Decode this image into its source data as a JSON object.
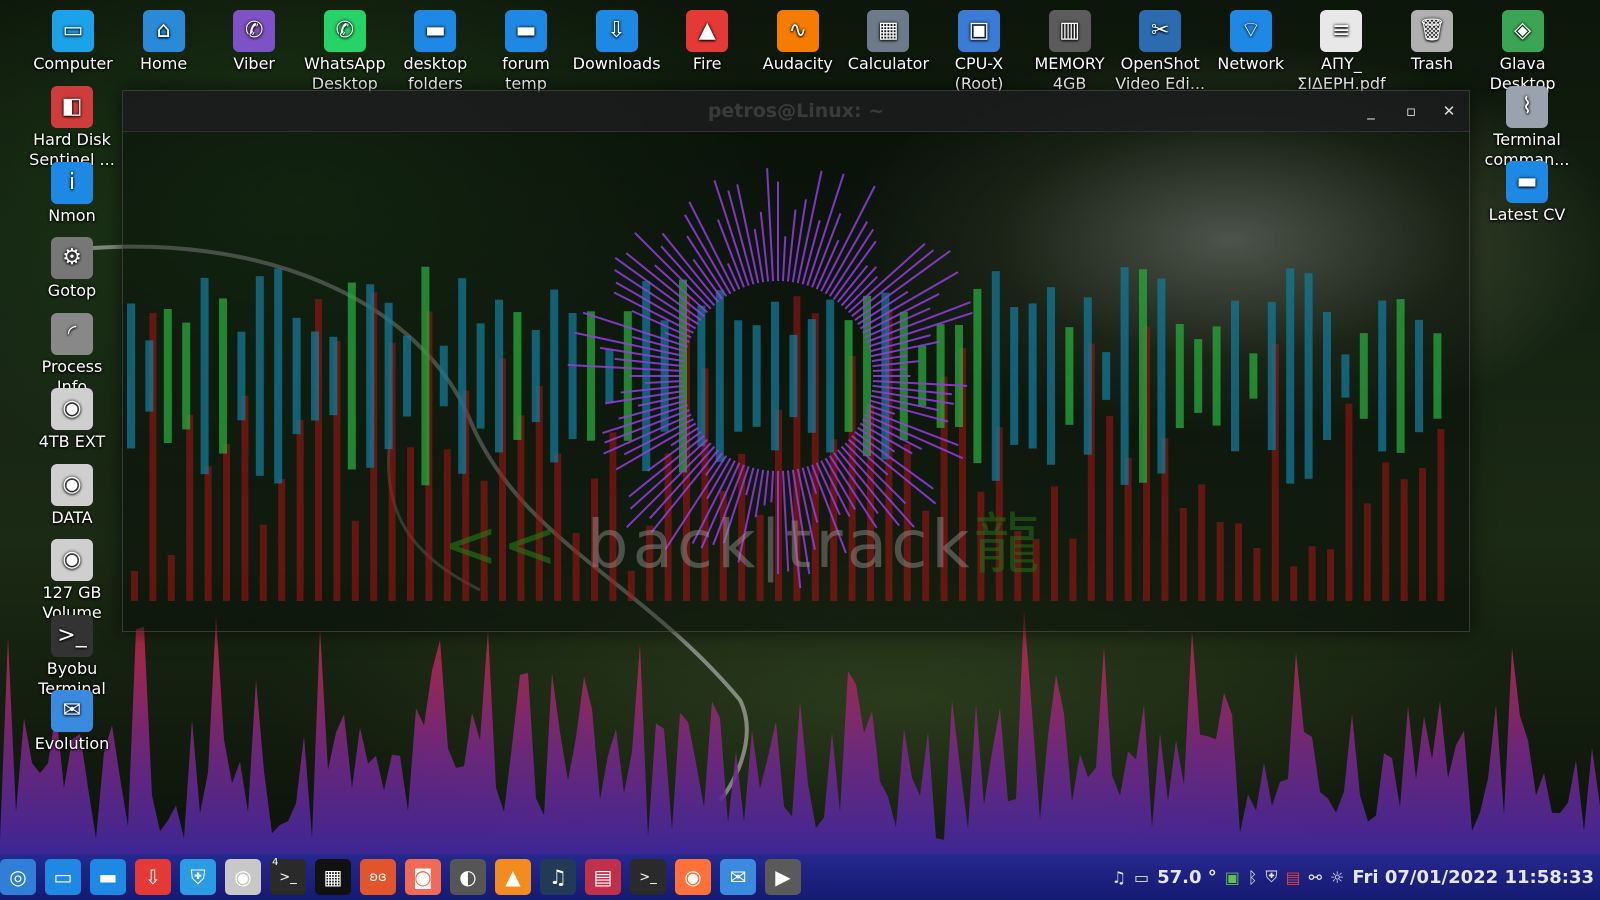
{
  "desktop": {
    "top_icons": [
      {
        "label": "Computer",
        "icon": "monitor-icon",
        "color": "#1aa3e8"
      },
      {
        "label": "Home",
        "icon": "home-folder-icon",
        "color": "#2a8ad8"
      },
      {
        "label": "Viber",
        "icon": "viber-icon",
        "color": "#7d52c7"
      },
      {
        "label": "WhatsApp Desktop",
        "icon": "whatsapp-icon",
        "color": "#25d366"
      },
      {
        "label": "desktop folders",
        "icon": "folder-icon",
        "color": "#1e88e5"
      },
      {
        "label": "forum temp",
        "icon": "folder-icon",
        "color": "#1e88e5"
      },
      {
        "label": "Downloads",
        "icon": "downloads-folder-icon",
        "color": "#1e88e5"
      },
      {
        "label": "Fire",
        "icon": "fire-app-icon",
        "color": "#e53935"
      },
      {
        "label": "Audacity",
        "icon": "audacity-icon",
        "color": "#f57c00"
      },
      {
        "label": "Calculator",
        "icon": "calculator-icon",
        "color": "#6d7a8a"
      },
      {
        "label": "CPU-X (Root)",
        "icon": "cpu-icon",
        "color": "#3a7bd5"
      },
      {
        "label": "MEMORY 4GB",
        "icon": "memory-card-icon",
        "color": "#5c5c5c"
      },
      {
        "label": "OpenShot Video Edi...",
        "icon": "openshot-icon",
        "color": "#2b6cb0"
      },
      {
        "label": "Network",
        "icon": "network-folder-icon",
        "color": "#1e88e5"
      },
      {
        "label": "ΑΠΥ_ ΣΙΔΕΡΗ.pdf",
        "icon": "document-icon",
        "color": "#e8e8e8"
      },
      {
        "label": "Trash",
        "icon": "trash-icon",
        "color": "#b0b0b0"
      },
      {
        "label": "Glava Desktop",
        "icon": "glava-icon",
        "color": "#3aa655"
      }
    ],
    "left_icons": [
      {
        "label": "Hard Disk Sentinel ...",
        "icon": "hard-disk-sentinel-icon",
        "color": "#d03c3c"
      },
      {
        "label": "Nmon",
        "icon": "info-icon",
        "color": "#1e88e5"
      },
      {
        "label": "Gotop",
        "icon": "gear-icon",
        "color": "#777777"
      },
      {
        "label": "Process Info",
        "icon": "process-spinner-icon",
        "color": "#888888"
      },
      {
        "label": "4TB EXT",
        "icon": "drive-icon",
        "color": "#cfcfcf"
      },
      {
        "label": "DATA",
        "icon": "drive-icon",
        "color": "#cfcfcf"
      },
      {
        "label": "127 GB Volume",
        "icon": "drive-icon",
        "color": "#cfcfcf"
      },
      {
        "label": "Byobu Terminal",
        "icon": "terminal-icon",
        "color": "#333333"
      },
      {
        "label": "Evolution",
        "icon": "mail-icon",
        "color": "#3a8be0"
      }
    ],
    "right_icons": [
      {
        "label": "Terminal comman...",
        "icon": "paperclip-icon",
        "color": "#9aa3ad"
      },
      {
        "label": "Latest CV",
        "icon": "folder-icon",
        "color": "#1e88e5"
      }
    ]
  },
  "window": {
    "title": "petros@Linux: ~",
    "minimize_glyph": "_",
    "maximize_glyph": "▫",
    "close_glyph": "✕"
  },
  "wallpaper": {
    "chevrons": "<<",
    "brand": "back|track",
    "dragon": "龍"
  },
  "taskbar": {
    "apps": [
      {
        "name": "menu-button",
        "icon": "menu-icon",
        "color": "#2f7fd8"
      },
      {
        "name": "file-manager",
        "icon": "window-icon",
        "color": "#1e88e5"
      },
      {
        "name": "files",
        "icon": "folder-icon",
        "color": "#1e88e5"
      },
      {
        "name": "downloader",
        "icon": "download-arrow-icon",
        "color": "#e53935"
      },
      {
        "name": "vpn",
        "icon": "shield-lock-icon",
        "color": "#2b9be3"
      },
      {
        "name": "disks",
        "icon": "disk-icon",
        "color": "#c8c8c8"
      },
      {
        "name": "terminal-4",
        "icon": "terminal-icon",
        "color": "#2a2a2a"
      },
      {
        "name": "calculator",
        "icon": "keypad-icon",
        "color": "#111111"
      },
      {
        "name": "butterfly-app",
        "icon": "butterfly-icon",
        "color": "#e0552b"
      },
      {
        "name": "screenshot",
        "icon": "camera-icon",
        "color": "#f06a55"
      },
      {
        "name": "nautilus",
        "icon": "shell-icon",
        "color": "#555555"
      },
      {
        "name": "vlc",
        "icon": "vlc-cone-icon",
        "color": "#f28c1f"
      },
      {
        "name": "music-player",
        "icon": "music-note-icon",
        "color": "#223a55"
      },
      {
        "name": "media-app",
        "icon": "calendar-icon",
        "color": "#c0304a"
      },
      {
        "name": "terminal",
        "icon": "terminal-icon",
        "color": "#2a2a2a"
      },
      {
        "name": "firefox",
        "icon": "firefox-icon",
        "color": "#ff7139"
      },
      {
        "name": "evolution",
        "icon": "mail-icon",
        "color": "#3a8be0"
      },
      {
        "name": "video-app",
        "icon": "video-icon",
        "color": "#5a5a5a"
      }
    ],
    "terminal_badge": "4",
    "tray": {
      "temperature": "57.0 °",
      "datetime": "Fri 07/01/2022 11:58:33"
    }
  }
}
